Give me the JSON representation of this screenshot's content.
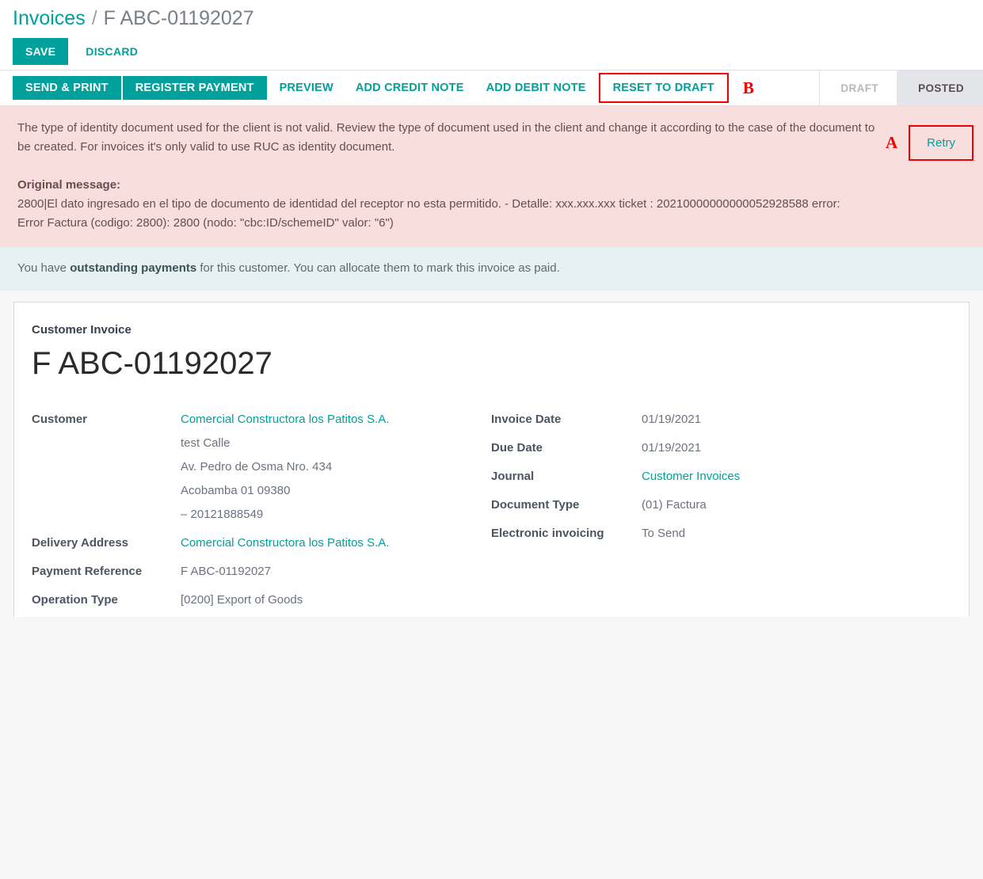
{
  "breadcrumb": {
    "root": "Invoices",
    "separator": "/",
    "current": "F ABC-01192027"
  },
  "savebar": {
    "save_label": "SAVE",
    "discard_label": "DISCARD"
  },
  "actionbar": {
    "buttons": [
      {
        "label": "SEND & PRINT",
        "style": "primary"
      },
      {
        "label": "REGISTER PAYMENT",
        "style": "primary"
      },
      {
        "label": "PREVIEW",
        "style": "link"
      },
      {
        "label": "ADD CREDIT NOTE",
        "style": "link"
      },
      {
        "label": "ADD DEBIT NOTE",
        "style": "link"
      },
      {
        "label": "RESET TO DRAFT",
        "style": "link-outlined"
      }
    ],
    "annotation_b": "B"
  },
  "statusbar": {
    "stages": [
      {
        "label": "DRAFT",
        "active": false
      },
      {
        "label": "POSTED",
        "active": true
      }
    ]
  },
  "error_alert": {
    "message": "The type of identity document used for the client is not valid. Review the type of document used in the client and change it according to the case of the document to be created. For invoices it's only valid to use RUC as identity document.",
    "original_title": "Original message:",
    "original_line1": "2800|El dato ingresado en el tipo de documento de identidad del receptor no esta permitido. - Detalle: xxx.xxx.xxx ticket : 20210000000000052928588 error:",
    "original_line2": "Error Factura (codigo: 2800): 2800 (nodo: \"cbc:ID/schemeID\" valor: \"6\")",
    "annotation_a": "A",
    "retry_label": "Retry"
  },
  "info_alert": {
    "prefix": "You have ",
    "bold": "outstanding payments",
    "suffix": " for this customer. You can allocate them to mark this invoice as paid."
  },
  "invoice": {
    "subtitle": "Customer Invoice",
    "number": "F ABC-01192027",
    "left_fields": [
      {
        "label": "Customer",
        "value": "Comercial Constructora los Patitos S.A.",
        "is_link": true
      },
      {
        "label": "Delivery Address",
        "value": "Comercial Constructora los Patitos S.A.",
        "is_link": true
      },
      {
        "label": "Payment Reference",
        "value": "F ABC-01192027",
        "is_link": false
      },
      {
        "label": "Operation Type",
        "value": "[0200] Export of Goods",
        "is_link": false
      }
    ],
    "customer_address": [
      "test Calle",
      "Av. Pedro de Osma Nro. 434",
      "Acobamba 01 09380",
      "– 20121888549"
    ],
    "right_fields": [
      {
        "label": "Invoice Date",
        "value": "01/19/2021",
        "is_link": false
      },
      {
        "label": "Due Date",
        "value": "01/19/2021",
        "is_link": false
      },
      {
        "label": "Journal",
        "value": "Customer Invoices",
        "is_link": true
      },
      {
        "label": "Document Type",
        "value": "(01) Factura",
        "is_link": false
      },
      {
        "label": "Electronic invoicing",
        "value": "To Send",
        "is_link": false
      }
    ]
  },
  "colors": {
    "accent_teal": "#00A09D",
    "danger_bg": "#f9dede",
    "info_bg": "#e7f1f3",
    "annotation_red": "#f00000",
    "stage_active_bg": "#e3e5e8"
  }
}
